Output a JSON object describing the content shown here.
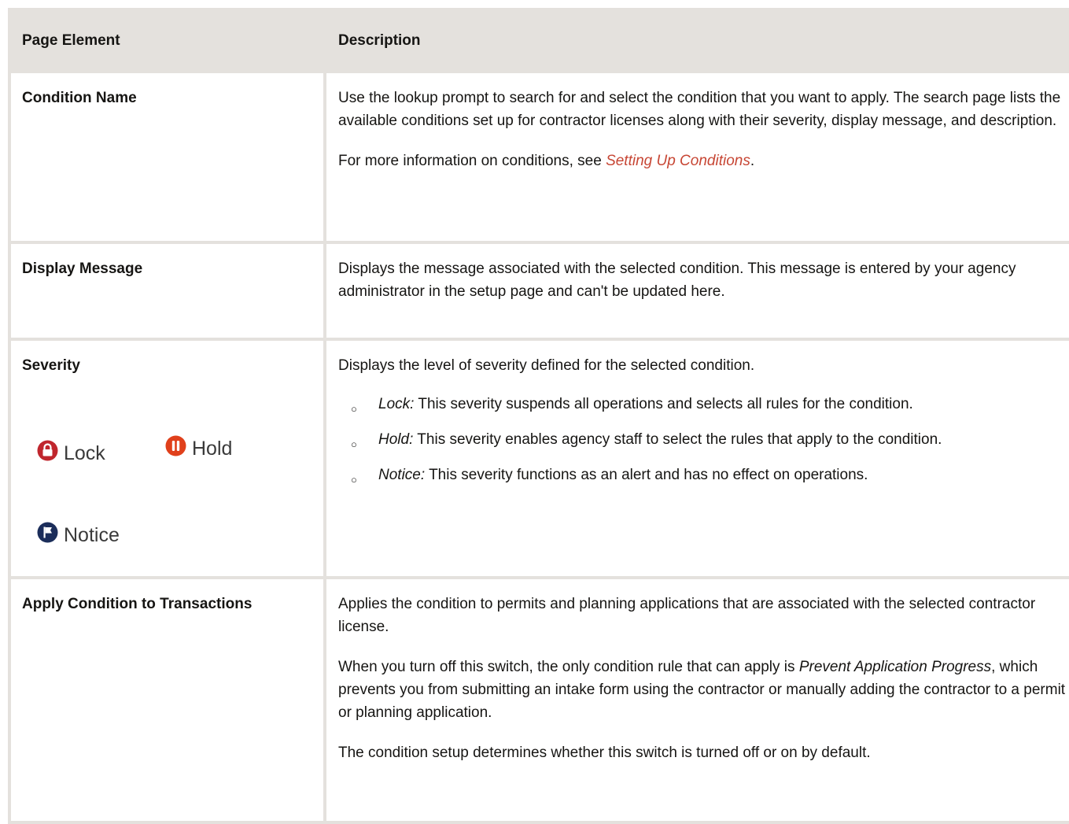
{
  "table": {
    "headers": [
      "Page Element",
      "Description"
    ],
    "rows": {
      "condition_name": {
        "element": "Condition Name",
        "p1": "Use the lookup prompt to search for and select the condition that you want to apply. The search page lists the available conditions set up for contractor licenses along with their severity, display message, and description.",
        "p2_prefix": "For more information on conditions, see ",
        "p2_link": "Setting Up Conditions",
        "p2_suffix": "."
      },
      "display_message": {
        "element": "Display Message",
        "p1": "Displays the message associated with the selected condition. This message is entered by your agency administrator in the setup page and can't be updated here."
      },
      "severity": {
        "element": "Severity",
        "icons": {
          "lock": "Lock",
          "hold": "Hold",
          "notice": "Notice"
        },
        "p1": "Displays the level of severity defined for the selected condition.",
        "items": [
          {
            "term": "Lock:",
            "text": " This severity suspends all operations and selects all rules for the condition."
          },
          {
            "term": "Hold:",
            "text": " This severity enables agency staff to select the rules that apply to the condition."
          },
          {
            "term": "Notice:",
            "text": " This severity functions as an alert and has no effect on operations."
          }
        ]
      },
      "apply_condition": {
        "element": "Apply Condition to Transactions",
        "p1": "Applies the condition to permits and planning applications that are associated with the selected contractor license.",
        "p2_prefix": "When you turn off this switch, the only condition rule that can apply is ",
        "p2_em": "Prevent Application Progress",
        "p2_suffix": ", which prevents you from submitting an intake form using the contractor or manually adding the contractor to a permit or planning application.",
        "p3": "The condition setup determines whether this switch is turned off or on by default."
      }
    }
  },
  "colors": {
    "header_bg": "#e4e1dd",
    "link": "#c74634",
    "lock_icon": "#c0262d",
    "hold_icon": "#e0401b",
    "notice_icon": "#1b2d5a"
  },
  "icons": {
    "lock": "lock-icon",
    "hold": "pause-icon",
    "notice": "flag-icon"
  }
}
